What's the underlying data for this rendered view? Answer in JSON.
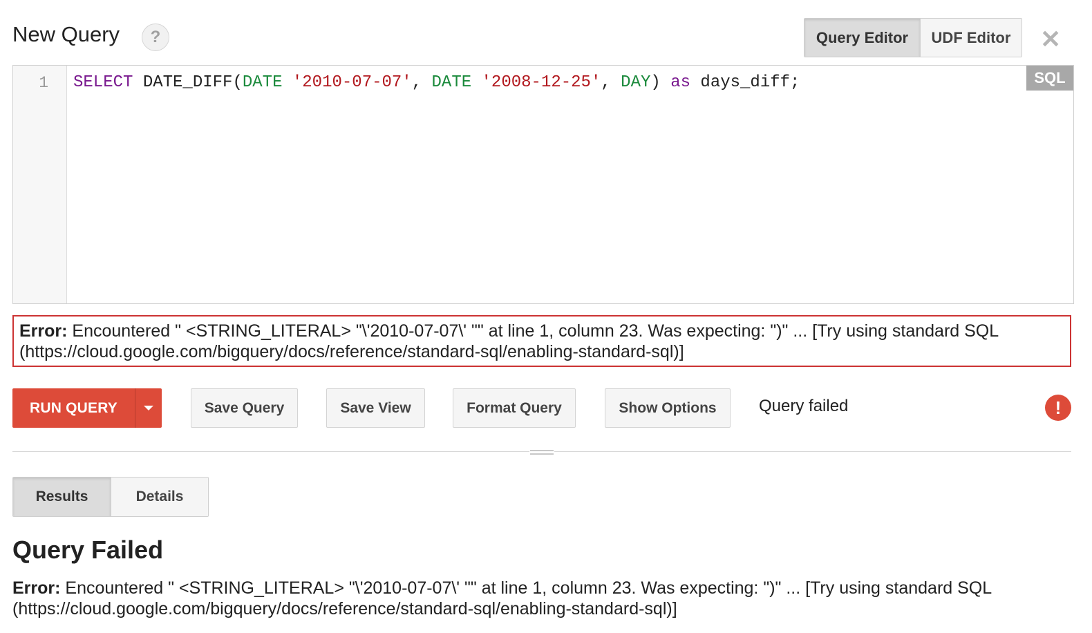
{
  "header": {
    "title": "New Query",
    "help_icon": "?",
    "tabs": [
      {
        "label": "Query Editor",
        "active": true
      },
      {
        "label": "UDF Editor",
        "active": false
      }
    ],
    "close_icon": "✕"
  },
  "editor": {
    "line_number": "1",
    "language_badge": "SQL",
    "code_tokens": [
      {
        "text": "SELECT",
        "kind": "keyword"
      },
      {
        "text": " DATE_DIFF(",
        "kind": "plain"
      },
      {
        "text": "DATE",
        "kind": "type"
      },
      {
        "text": " ",
        "kind": "plain"
      },
      {
        "text": "'2010-07-07'",
        "kind": "string"
      },
      {
        "text": ", ",
        "kind": "plain"
      },
      {
        "text": "DATE",
        "kind": "type"
      },
      {
        "text": " ",
        "kind": "plain"
      },
      {
        "text": "'2008-12-25'",
        "kind": "string"
      },
      {
        "text": ", ",
        "kind": "plain"
      },
      {
        "text": "DAY",
        "kind": "type"
      },
      {
        "text": ") ",
        "kind": "plain"
      },
      {
        "text": "as",
        "kind": "keyword"
      },
      {
        "text": " days_diff;",
        "kind": "plain"
      }
    ],
    "colors": {
      "keyword": "#7a1a8f",
      "type": "#1b8a3c",
      "string": "#b2181e"
    }
  },
  "error_box": {
    "label": "Error:",
    "message": " Encountered \" <STRING_LITERAL> \"\\'2010-07-07\\' \"\" at line 1, column 23. Was expecting: \")\" ... [Try using standard SQL (https://cloud.google.com/bigquery/docs/reference/standard-sql/enabling-standard-sql)]"
  },
  "toolbar": {
    "run_label": "RUN QUERY",
    "save_query_label": "Save Query",
    "save_view_label": "Save View",
    "format_query_label": "Format Query",
    "show_options_label": "Show Options",
    "status": "Query failed",
    "alert_icon": "!"
  },
  "results": {
    "tabs": [
      {
        "label": "Results",
        "active": true
      },
      {
        "label": "Details",
        "active": false
      }
    ],
    "title": "Query Failed",
    "error_label": "Error:",
    "error_message": " Encountered \" <STRING_LITERAL> \"\\'2010-07-07\\' \"\" at line 1, column 23. Was expecting: \")\" ... [Try using standard SQL (https://cloud.google.com/bigquery/docs/reference/standard-sql/enabling-standard-sql)]"
  },
  "colors": {
    "run_button": "#dd4b39",
    "error_border": "#cc3333",
    "alert": "#dd4b39"
  }
}
